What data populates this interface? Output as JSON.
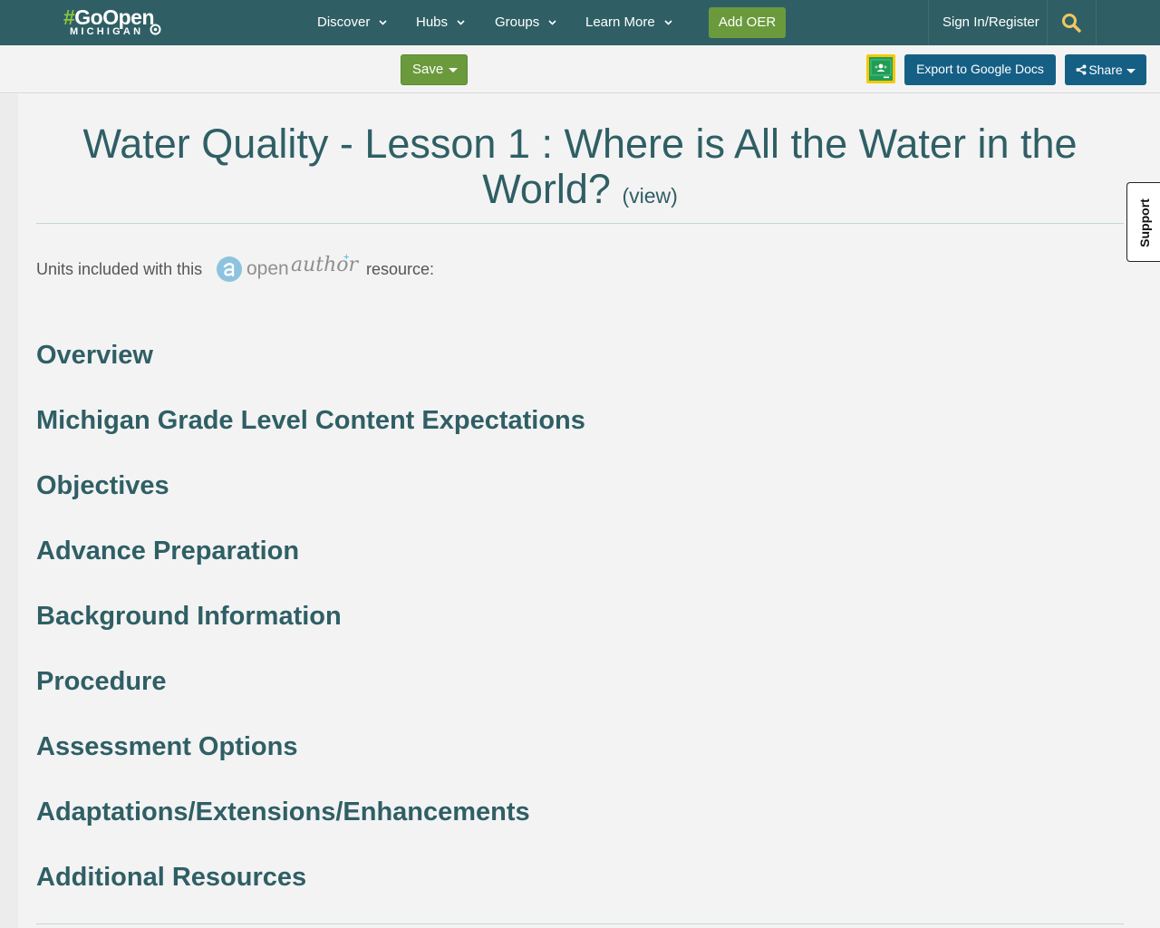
{
  "logo": {
    "hash": "#",
    "go_open": "GoOpen",
    "subtitle": "MICHIGAN"
  },
  "nav": {
    "discover": "Discover",
    "hubs": "Hubs",
    "groups": "Groups",
    "learn_more": "Learn More",
    "add_oer": "Add OER",
    "sign_in": "Sign In/Register"
  },
  "toolbar": {
    "save": "Save",
    "export": "Export to Google Docs",
    "share": "Share"
  },
  "page": {
    "title": "Water Quality - Lesson 1 : Where is All the Water in the World?",
    "view_link": "(view)",
    "units_prefix": "Units included with this",
    "units_suffix": "resource:",
    "openauthor_open": "open",
    "openauthor_author": "author",
    "openauthor_plus": "+"
  },
  "sections": [
    "Overview",
    "Michigan Grade Level Content Expectations",
    "Objectives",
    "Advance Preparation",
    "Background Information",
    "Procedure",
    "Assessment Options",
    "Adaptations/Extensions/Enhancements",
    "Additional Resources"
  ],
  "support": {
    "label": "Support"
  },
  "colors": {
    "nav_bg": "#2f5f65",
    "accent_green": "#6a9a3c",
    "button_blue": "#155f85",
    "heading_teal": "#2f5f65",
    "search_icon": "#f0c860"
  }
}
